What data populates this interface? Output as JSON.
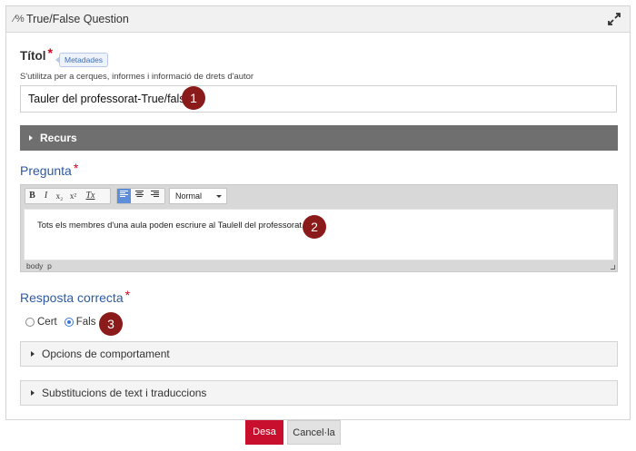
{
  "header": {
    "icon": "percent-fraction-icon",
    "title": "True/False Question",
    "expand_icon": "expand-arrows-icon"
  },
  "title_field": {
    "label": "Títol",
    "required_mark": "*",
    "metadata_badge": "Metadades",
    "hint": "S'utilitza per a cerques, informes i informació de drets d'autor",
    "value": "Tauler del professorat-True/false"
  },
  "markers": [
    "1",
    "2",
    "3"
  ],
  "recurs": {
    "label": "Recurs"
  },
  "question": {
    "label": "Pregunta",
    "required_mark": "*",
    "toolbar": {
      "bold": "B",
      "italic": "I",
      "subscript": "x₂",
      "superscript": "x²",
      "clear_format": "Tx",
      "format_select": "Normal"
    },
    "body_text": "Tots els membres d'una aula poden escriure al Taulell del professorat.",
    "status_path": [
      "body",
      "p"
    ]
  },
  "correct_answer": {
    "label": "Resposta correcta",
    "required_mark": "*",
    "options": [
      {
        "label": "Cert",
        "checked": false
      },
      {
        "label": "Fals",
        "checked": true
      }
    ]
  },
  "sections": [
    "Opcions de comportament",
    "Substitucions de text i traduccions"
  ],
  "actions": {
    "save": "Desa",
    "cancel": "Cancel·la"
  },
  "colors": {
    "marker": "#8b1a1a",
    "save": "#c8102e",
    "section_label": "#2d5aa0",
    "recurs_bar": "#6f6f6f"
  }
}
